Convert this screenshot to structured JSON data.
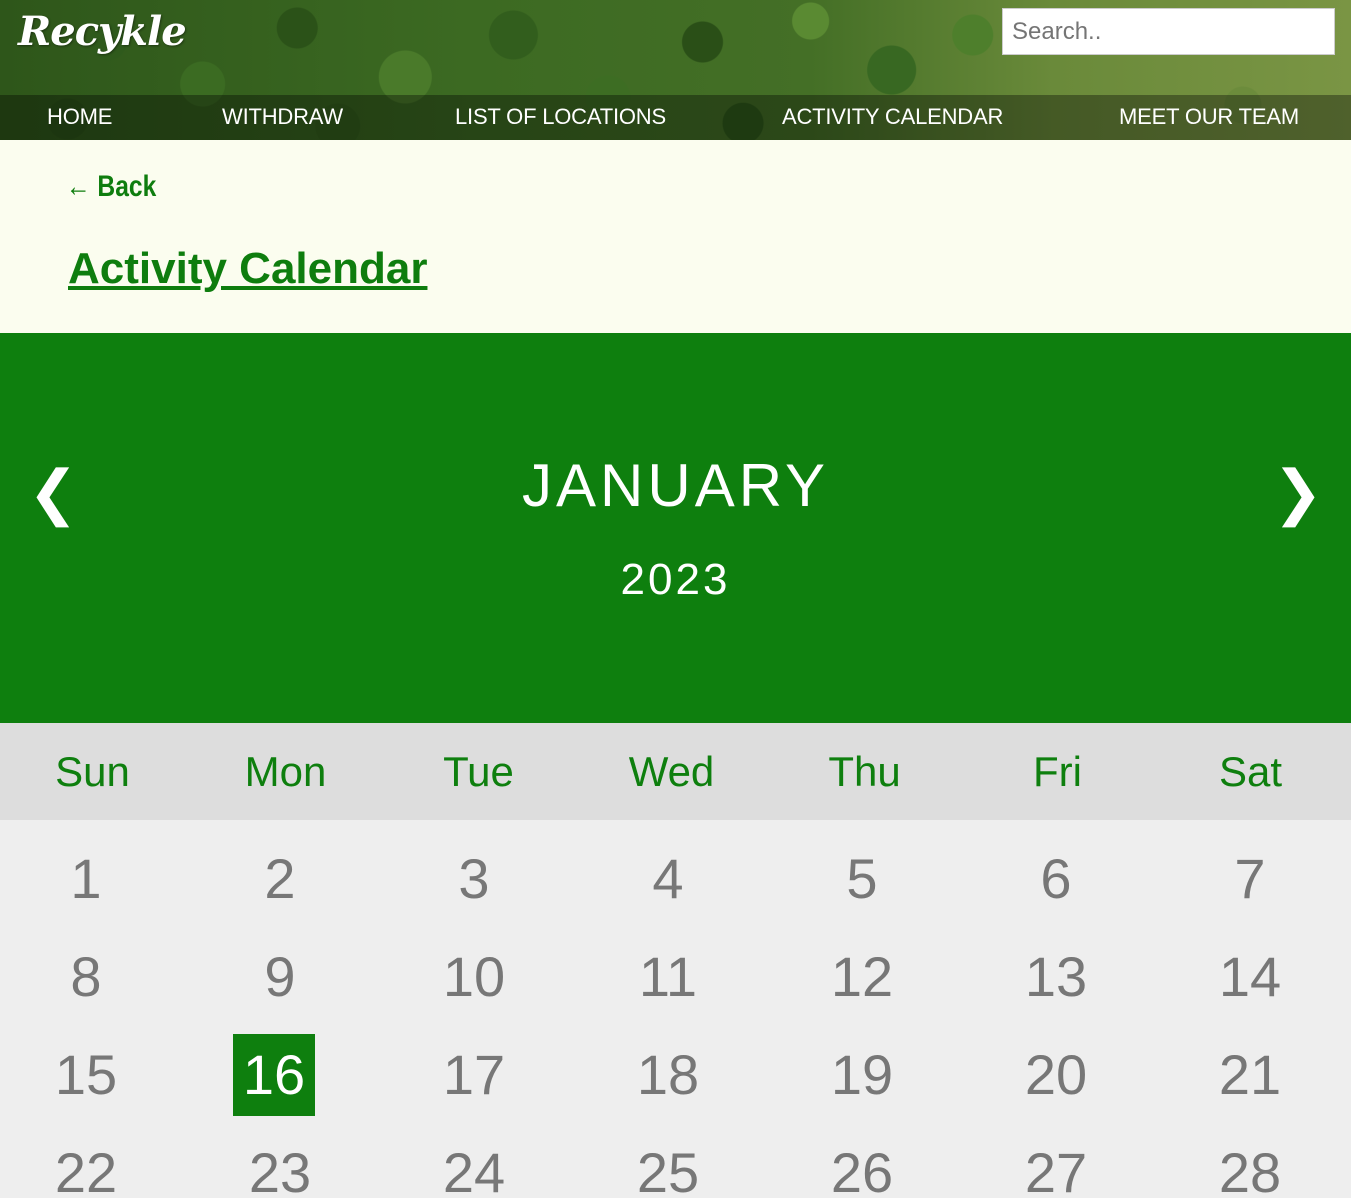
{
  "header": {
    "logo": "Recykle",
    "search_placeholder": "Search..",
    "nav": [
      "HOME",
      "WITHDRAW",
      "LIST OF LOCATIONS",
      "ACTIVITY CALENDAR",
      "MEET OUR TEAM"
    ]
  },
  "page": {
    "back_label": "← Back",
    "title": "Activity Calendar"
  },
  "calendar": {
    "month": "JANUARY",
    "year": "2023",
    "prev_icon": "❮",
    "next_icon": "❯",
    "weekdays": [
      "Sun",
      "Mon",
      "Tue",
      "Wed",
      "Thu",
      "Fri",
      "Sat"
    ],
    "days": [
      1,
      2,
      3,
      4,
      5,
      6,
      7,
      8,
      9,
      10,
      11,
      12,
      13,
      14,
      15,
      16,
      17,
      18,
      19,
      20,
      21,
      22,
      23,
      24,
      25,
      26,
      27,
      28
    ],
    "active_day": 16
  },
  "colors": {
    "brand_green": "#0e7f0e",
    "weekday_bg": "#dddddd",
    "days_bg": "#eeeeee",
    "title_bg": "#fbfdef",
    "day_text": "#777777"
  }
}
